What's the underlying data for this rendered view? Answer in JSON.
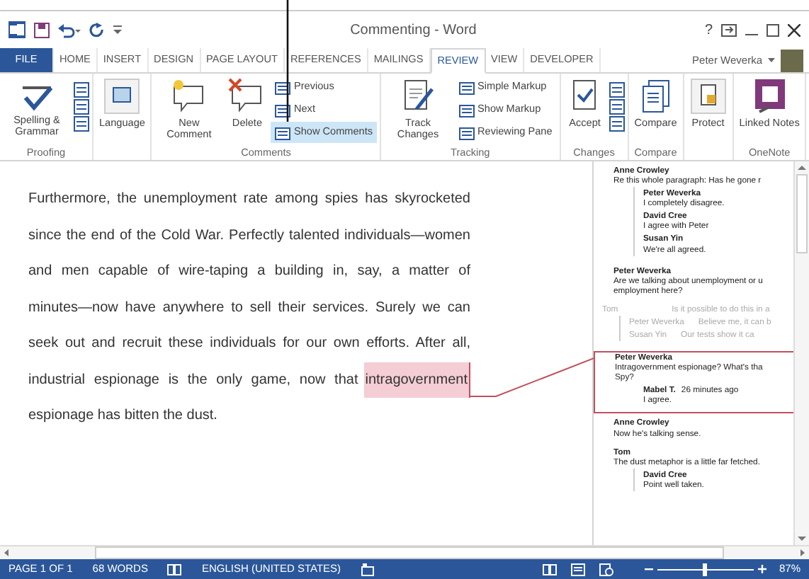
{
  "title_bar": {
    "title": "Commenting - Word",
    "help": "?"
  },
  "tabs": [
    {
      "label": "FILE",
      "kind": "file",
      "selected": false
    },
    {
      "label": "HOME",
      "kind": "tab",
      "selected": false
    },
    {
      "label": "INSERT",
      "kind": "tab",
      "selected": false
    },
    {
      "label": "DESIGN",
      "kind": "tab",
      "selected": false
    },
    {
      "label": "PAGE LAYOUT",
      "kind": "tab",
      "selected": false
    },
    {
      "label": "REFERENCES",
      "kind": "tab",
      "selected": false
    },
    {
      "label": "MAILINGS",
      "kind": "tab",
      "selected": false
    },
    {
      "label": "REVIEW",
      "kind": "tab",
      "selected": true
    },
    {
      "label": "VIEW",
      "kind": "tab",
      "selected": false
    },
    {
      "label": "DEVELOPER",
      "kind": "tab",
      "selected": false
    }
  ],
  "user": {
    "name": "Peter Weverka"
  },
  "ribbon": [
    {
      "label": "Proofing",
      "buttons": [
        {
          "kind": "large",
          "label": "Spelling & Grammar"
        },
        {
          "kind": "iconcol"
        }
      ]
    },
    {
      "buttons": [
        {
          "kind": "large",
          "label": "Language"
        }
      ]
    },
    {
      "label": "Comments",
      "buttons": [
        {
          "kind": "large",
          "label": "New Comment"
        },
        {
          "kind": "large",
          "label": "Delete"
        },
        {
          "kind": "small",
          "items": [
            {
              "label": "Previous",
              "selected": false
            },
            {
              "label": "Next",
              "selected": false
            },
            {
              "label": "Show Comments",
              "selected": true
            }
          ]
        }
      ]
    },
    {
      "label": "Tracking",
      "buttons": [
        {
          "kind": "large",
          "label": "Track Changes"
        },
        {
          "kind": "small",
          "items": [
            {
              "label": "Simple Markup",
              "selected": false
            },
            {
              "label": "Show Markup",
              "selected": false
            },
            {
              "label": "Reviewing Pane",
              "selected": false
            }
          ]
        }
      ]
    },
    {
      "label": "Changes",
      "buttons": [
        {
          "kind": "large",
          "label": "Accept"
        },
        {
          "kind": "iconcol"
        }
      ]
    },
    {
      "label": "Compare",
      "buttons": [
        {
          "kind": "large",
          "label": "Compare"
        }
      ]
    },
    {
      "buttons": [
        {
          "kind": "large",
          "label": "Protect"
        }
      ]
    },
    {
      "label": "OneNote",
      "buttons": [
        {
          "kind": "large",
          "label": "Linked Notes"
        }
      ]
    }
  ],
  "document": {
    "lines": [
      {
        "segments": [
          {
            "text": "Furthermore, the unemployment rate among spies has skyrocketed",
            "highlighted": false
          }
        ]
      },
      {
        "segments": [
          {
            "text": "since the end of the Cold War. Perfectly talented individuals—women",
            "highlighted": false
          }
        ]
      },
      {
        "segments": [
          {
            "text": "and men capable of wire-taping a building in, say, a matter of",
            "highlighted": false
          }
        ]
      },
      {
        "segments": [
          {
            "text": "minutes—now have anywhere to sell their services. Surely we can",
            "highlighted": false
          }
        ]
      },
      {
        "segments": [
          {
            "text": "seek out and recruit these individuals for our own efforts. After all,",
            "highlighted": false
          }
        ]
      },
      {
        "segments": [
          {
            "text": "industrial espionage is the only game, now that",
            "highlighted": false
          },
          {
            "text": "intragovernment",
            "highlighted": true
          }
        ]
      },
      {
        "segments": [
          {
            "text": "espionage has bitten the dust.",
            "highlighted": false
          }
        ]
      }
    ]
  },
  "comments_pane": {
    "threads": [
      {
        "author": "Anne Crowley",
        "text_lines": [
          "Re this whole paragraph: Has he gone r"
        ],
        "resolved": false,
        "selected": false,
        "replies": [
          {
            "author": "Peter Weverka",
            "text": "I completely disagree."
          },
          {
            "author": "David Cree",
            "text": "I agree with Peter"
          },
          {
            "author": "Susan Yin",
            "text": "We're all agreed."
          }
        ]
      },
      {
        "author": "Peter Weverka",
        "text_lines": [
          "Are we talking about unemployment or u",
          "employment here?"
        ],
        "resolved": false,
        "selected": false
      },
      {
        "author": "Tom",
        "text_lines": [
          "Is it possible to do this in a"
        ],
        "resolved": true,
        "selected": false,
        "replies": [
          {
            "author": "Peter Weverka",
            "text": "Believe me, it can b"
          },
          {
            "author": "Susan Yin",
            "text": "Our tests show it ca"
          }
        ]
      },
      {
        "author": "Peter Weverka",
        "text_lines": [
          "Intragovernment espionage? What's tha",
          "Spy?"
        ],
        "resolved": false,
        "selected": true,
        "replies": [
          {
            "author": "Mabel T.",
            "time": "26 minutes ago",
            "text": "I agree."
          }
        ]
      },
      {
        "author": "Anne Crowley",
        "text_lines": [
          "Now he's talking sense."
        ],
        "resolved": false,
        "selected": false
      },
      {
        "author": "Tom",
        "text_lines": [
          "The dust metaphor is a little far fetched."
        ],
        "resolved": false,
        "selected": false,
        "replies": [
          {
            "author": "David Cree",
            "text": "Point well taken."
          }
        ]
      }
    ]
  },
  "status_bar": {
    "page": "PAGE 1 OF 1",
    "words": "68 WORDS",
    "language": "ENGLISH (UNITED STATES)",
    "zoom": {
      "level": 0.5
    },
    "zoom_label": "87%"
  }
}
